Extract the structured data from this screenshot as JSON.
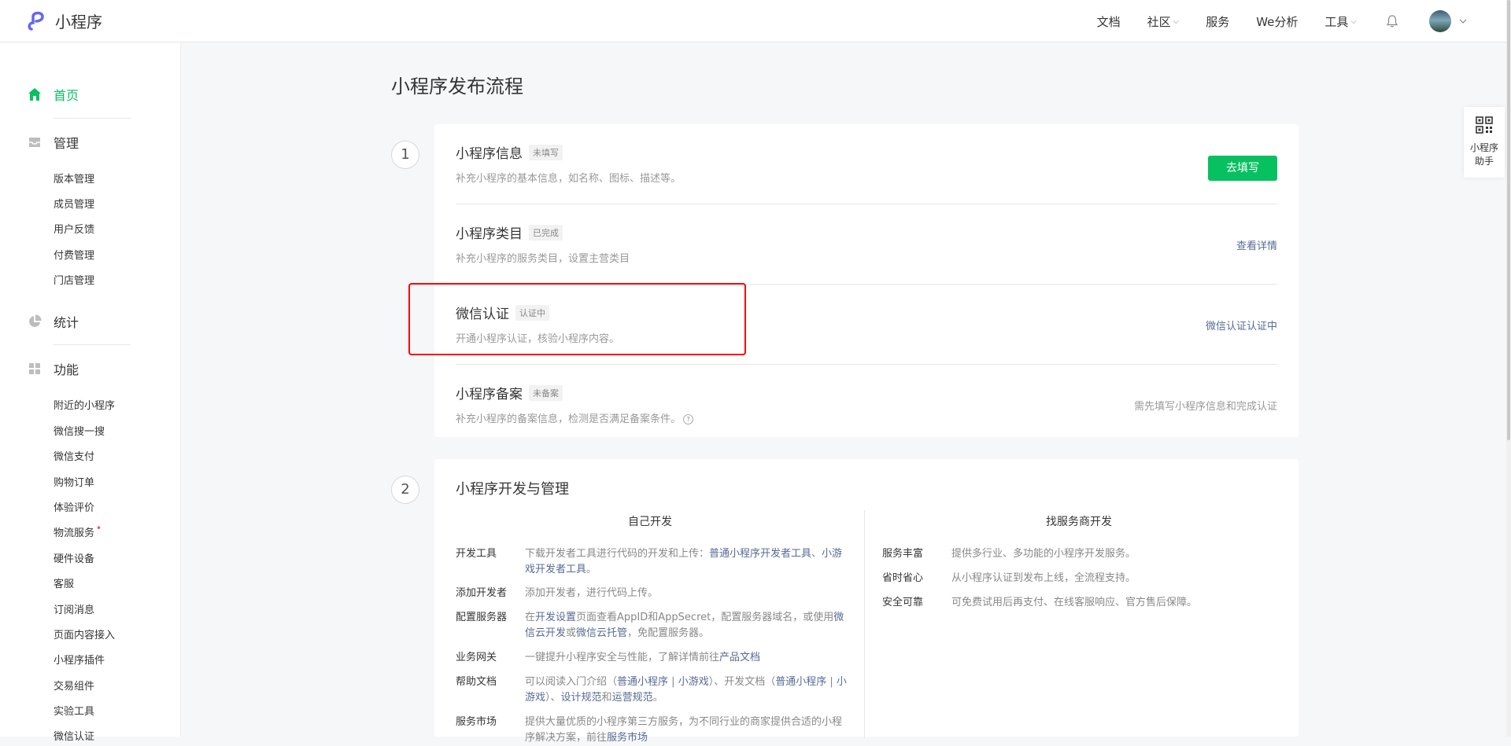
{
  "app": {
    "logo_text": "小程序"
  },
  "nav": {
    "items": [
      {
        "label": "文档",
        "chevron": false
      },
      {
        "label": "社区",
        "chevron": true
      },
      {
        "label": "服务",
        "chevron": false
      },
      {
        "label": "We分析",
        "chevron": false
      },
      {
        "label": "工具",
        "chevron": true
      }
    ]
  },
  "sidebar": {
    "home": "首页",
    "manage": {
      "label": "管理",
      "items": [
        "版本管理",
        "成员管理",
        "用户反馈",
        "付费管理",
        "门店管理"
      ]
    },
    "stats": "统计",
    "features": {
      "label": "功能",
      "items": [
        "附近的小程序",
        "微信搜一搜",
        "微信支付",
        "购物订单",
        "体验评价",
        "物流服务",
        "硬件设备",
        "客服",
        "订阅消息",
        "页面内容接入",
        "小程序插件",
        "交易组件",
        "实验工具",
        "微信认证"
      ]
    }
  },
  "main": {
    "title": "小程序发布流程",
    "step1": {
      "number": "1",
      "rows": [
        {
          "title": "小程序信息",
          "tag": "未填写",
          "desc": "补充小程序的基本信息，如名称、图标、描述等。",
          "action": "去填写"
        },
        {
          "title": "小程序类目",
          "tag": "已完成",
          "desc": "补充小程序的服务类目，设置主营类目",
          "action": "查看详情"
        },
        {
          "title": "微信认证",
          "tag": "认证中",
          "desc": "开通小程序认证，核验小程序内容。",
          "action": "微信认证认证中"
        },
        {
          "title": "小程序备案",
          "tag": "未备案",
          "desc": "补充小程序的备案信息，检测是否满足备案条件。",
          "action": "需先填写小程序信息和完成认证"
        }
      ]
    },
    "step2": {
      "number": "2",
      "title": "小程序开发与管理",
      "self_dev": {
        "heading": "自己开发",
        "rows": [
          {
            "label": "开发工具",
            "text_a": "下载开发者工具进行代码的开发和上传：",
            "link_a": "普通小程序开发者工具",
            "text_b": "、",
            "link_b": "小游戏开发者工具",
            "text_c": "。"
          },
          {
            "label": "添加开发者",
            "text": "添加开发者，进行代码上传。"
          },
          {
            "label": "配置服务器",
            "text_a": "在",
            "link_a": "开发设置",
            "text_b": "页面查看AppID和AppSecret，配置服务器域名，或使用",
            "link_b": "微信云开发",
            "text_c": "或",
            "link_c": "微信云托管",
            "text_d": "，免配置服务器。"
          },
          {
            "label": "业务网关",
            "text_a": "一键提升小程序安全与性能，了解详情前往",
            "link_a": "产品文档"
          },
          {
            "label": "帮助文档",
            "text_a": "可以阅读入门介绍（",
            "link_a": "普通小程序",
            "text_b": " | ",
            "link_b": "小游戏",
            "text_c": "）、开发文档（",
            "link_c": "普通小程序",
            "text_d": " | ",
            "link_d": "小游戏",
            "text_e": "）、",
            "link_e": "设计规范",
            "text_f": "和",
            "link_f": "运营规范",
            "text_g": "。"
          },
          {
            "label": "服务市场",
            "text_a": "提供大量优质的小程序第三方服务，为不同行业的商家提供合适的小程序",
            "text_b": "解决方案，前往",
            "link_a": "服务市场"
          }
        ]
      },
      "vendor_dev": {
        "heading": "找服务商开发",
        "rows": [
          {
            "label": "服务丰富",
            "text": "提供多行业、多功能的小程序开发服务。"
          },
          {
            "label": "省时省心",
            "text": "从小程序认证到发布上线，全流程支持。"
          },
          {
            "label": "安全可靠",
            "text": "可免费试用后再支付、在线客服响应、官方售后保障。"
          }
        ]
      }
    }
  },
  "helper": {
    "line1": "小程序",
    "line2": "助手"
  },
  "colors": {
    "accent": "#07c160",
    "link": "#576b95",
    "highlight": "#ff0000"
  }
}
